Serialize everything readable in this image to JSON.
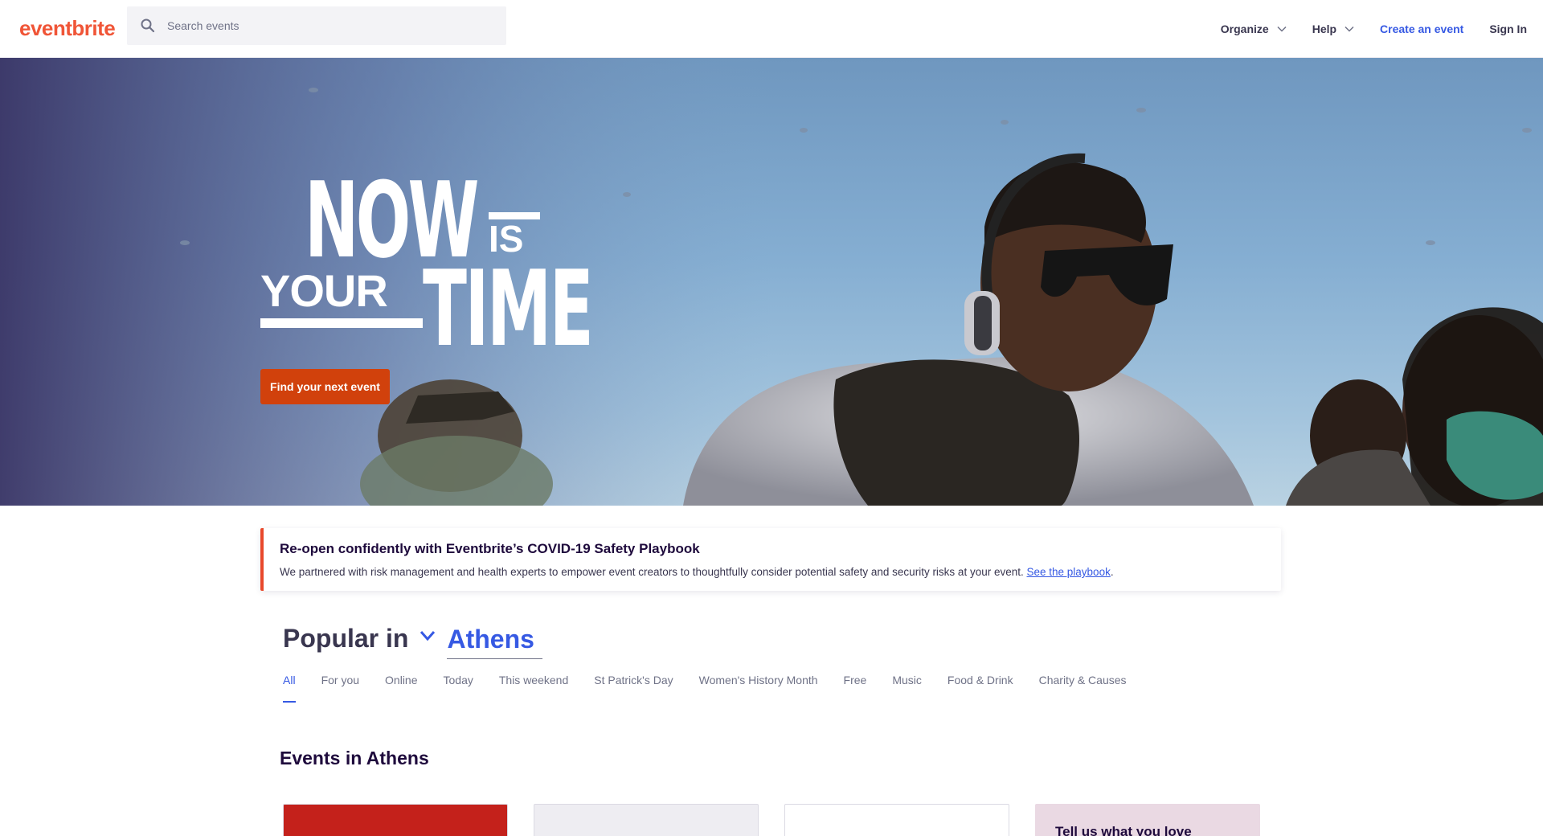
{
  "header": {
    "logo": "eventbrite",
    "search_placeholder": "Search events",
    "nav": {
      "organize": "Organize",
      "help": "Help",
      "create": "Create an event",
      "signin": "Sign In"
    }
  },
  "hero": {
    "word_now": "NOW",
    "word_is": "IS",
    "word_your": "YOUR",
    "word_time": "TIME",
    "cta": "Find your next event"
  },
  "banner": {
    "title": "Re-open confidently with Eventbrite’s COVID-19 Safety Playbook",
    "body": "We partnered with risk management and health experts to empower event creators to thoughtfully consider potential safety and security risks at your event.",
    "link": "See the playbook",
    "trailing": "."
  },
  "popular": {
    "label": "Popular in",
    "location": "Athens"
  },
  "tabs": [
    "All",
    "For you",
    "Online",
    "Today",
    "This weekend",
    "St Patrick's Day",
    "Women's History Month",
    "Free",
    "Music",
    "Food & Drink",
    "Charity & Causes"
  ],
  "active_tab": "All",
  "events_section": {
    "title": "Events in Athens",
    "card4_text": "Tell us what you love"
  },
  "colors": {
    "brand": "#f05537",
    "link": "#3659e3",
    "cta": "#d1410c",
    "banner_accent": "#e8482b"
  }
}
